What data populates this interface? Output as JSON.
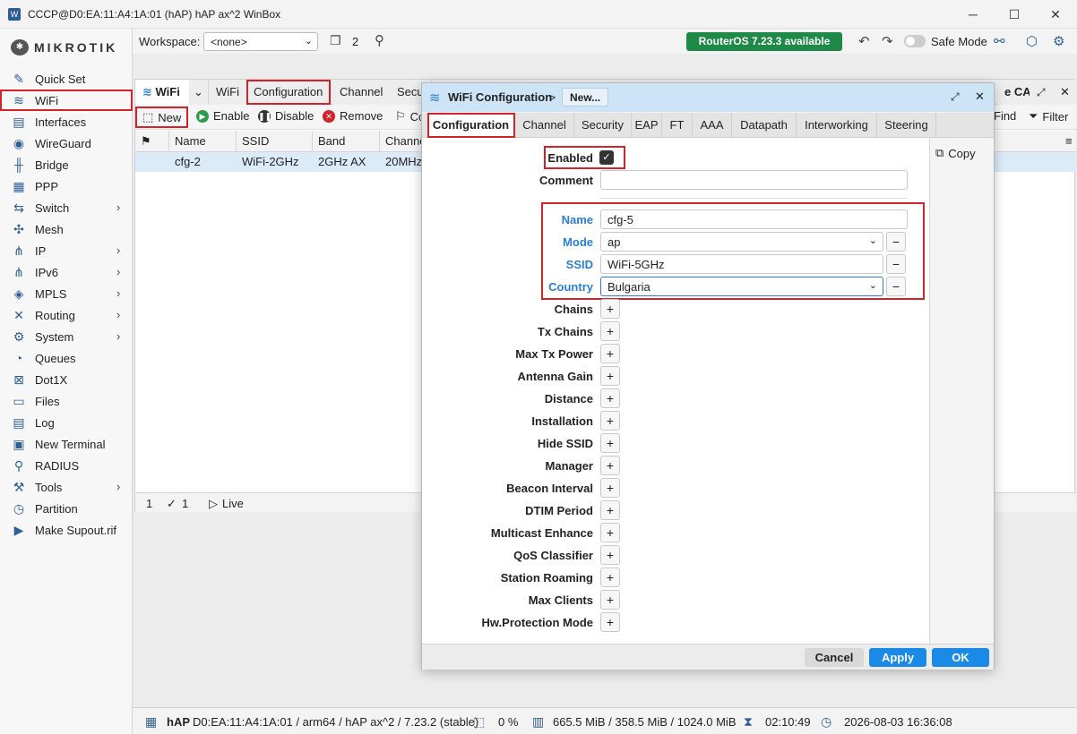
{
  "window": {
    "title": "CCCP@D0:EA:11:A4:1A:01 (hAP) hAP ax^2 WinBox",
    "minimize": "─",
    "maximize": "☐",
    "close": "✕"
  },
  "brand": {
    "logo_text": "MIKROTIK"
  },
  "sidebar": {
    "items": [
      {
        "label": "Quick Set",
        "icon": "quick-set-icon",
        "glyph": "✎"
      },
      {
        "label": "WiFi",
        "icon": "wifi-icon",
        "glyph": "≋"
      },
      {
        "label": "Interfaces",
        "icon": "interfaces-icon",
        "glyph": "▤"
      },
      {
        "label": "WireGuard",
        "icon": "wireguard-icon",
        "glyph": "◉"
      },
      {
        "label": "Bridge",
        "icon": "bridge-icon",
        "glyph": "╫"
      },
      {
        "label": "PPP",
        "icon": "ppp-icon",
        "glyph": "▦"
      },
      {
        "label": "Switch",
        "icon": "switch-icon",
        "glyph": "⇆",
        "chevron": "›"
      },
      {
        "label": "Mesh",
        "icon": "mesh-icon",
        "glyph": "✣"
      },
      {
        "label": "IP",
        "icon": "ip-icon",
        "glyph": "⋔",
        "chevron": "›"
      },
      {
        "label": "IPv6",
        "icon": "ipv6-icon",
        "glyph": "⋔",
        "chevron": "›"
      },
      {
        "label": "MPLS",
        "icon": "mpls-icon",
        "glyph": "◈",
        "chevron": "›"
      },
      {
        "label": "Routing",
        "icon": "routing-icon",
        "glyph": "✕",
        "chevron": "›"
      },
      {
        "label": "System",
        "icon": "system-icon",
        "glyph": "⚙",
        "chevron": "›"
      },
      {
        "label": "Queues",
        "icon": "queues-icon",
        "glyph": "◔"
      },
      {
        "label": "Dot1X",
        "icon": "dot1x-icon",
        "glyph": "⊠"
      },
      {
        "label": "Files",
        "icon": "files-icon",
        "glyph": "▭"
      },
      {
        "label": "Log",
        "icon": "log-icon",
        "glyph": "▤"
      },
      {
        "label": "New Terminal",
        "icon": "terminal-icon",
        "glyph": "▣"
      },
      {
        "label": "RADIUS",
        "icon": "radius-icon",
        "glyph": "⚲"
      },
      {
        "label": "Tools",
        "icon": "tools-icon",
        "glyph": "⚒",
        "chevron": "›"
      },
      {
        "label": "Partition",
        "icon": "partition-icon",
        "glyph": "◷"
      },
      {
        "label": "Make Supout.rif",
        "icon": "supout-icon",
        "glyph": "▶"
      }
    ]
  },
  "topbar": {
    "workspace_label": "Workspace:",
    "workspace_value": "<none>",
    "windows_count": "2",
    "update_label": "RouterOS 7.23.3 available",
    "safe_mode_label": "Safe Mode"
  },
  "bgwindow": {
    "tabs": [
      {
        "label": "WiFi"
      },
      {
        "label": "WiFi"
      },
      {
        "label": "Configuration"
      },
      {
        "label": "Channel"
      },
      {
        "label": "Secu"
      }
    ],
    "cap_tab": "e CAP",
    "toolbar": {
      "new": "New",
      "enable": "Enable",
      "disable": "Disable",
      "remove": "Remove",
      "cut": "Co",
      "find": "Find",
      "filter": "Filter"
    },
    "columns": [
      "Name",
      "SSID",
      "Band",
      "Channe"
    ],
    "rows": [
      {
        "name": "cfg-2",
        "ssid": "WiFi-2GHz",
        "band": "2GHz AX",
        "channel": "20MHz"
      }
    ],
    "status": {
      "count": "1",
      "selected": "1",
      "live": "Live"
    }
  },
  "dialog": {
    "title": "WiFi Configuration",
    "breadcrumb_sep": ">",
    "new_badge": "New...",
    "tabs": [
      "Configuration",
      "Channel",
      "Security",
      "EAP",
      "FT",
      "AAA",
      "Datapath",
      "Interworking",
      "Steering"
    ],
    "copy_label": "Copy",
    "fields": {
      "enabled_label": "Enabled",
      "comment_label": "Comment",
      "comment_value": "",
      "name_label": "Name",
      "name_value": "cfg-5",
      "mode_label": "Mode",
      "mode_value": "ap",
      "ssid_label": "SSID",
      "ssid_value": "WiFi-5GHz",
      "country_label": "Country",
      "country_value": "Bulgaria"
    },
    "expand_fields": [
      "Chains",
      "Tx Chains",
      "Max Tx Power",
      "Antenna Gain",
      "Distance",
      "Installation",
      "Hide SSID",
      "Manager",
      "Beacon Interval",
      "DTIM Period",
      "Multicast Enhance",
      "QoS Classifier",
      "Station Roaming",
      "Max Clients",
      "Hw.Protection Mode"
    ],
    "buttons": {
      "cancel": "Cancel",
      "apply": "Apply",
      "ok": "OK"
    }
  },
  "statusbar": {
    "device": "hAP",
    "device_info": "D0:EA:11:A4:1A:01 / arm64 / hAP ax^2 / 7.23.2 (stable)",
    "cpu": "0 %",
    "memory": "665.5 MiB / 358.5 MiB / 1024.0 MiB",
    "uptime": "02:10:49",
    "datetime": "2026-08-03 16:36:08"
  },
  "colors": {
    "accent_blue": "#2b7fd3",
    "update_green": "#1f8a48",
    "highlight_red": "#d6202a",
    "apply_blue": "#1a8ae6"
  }
}
